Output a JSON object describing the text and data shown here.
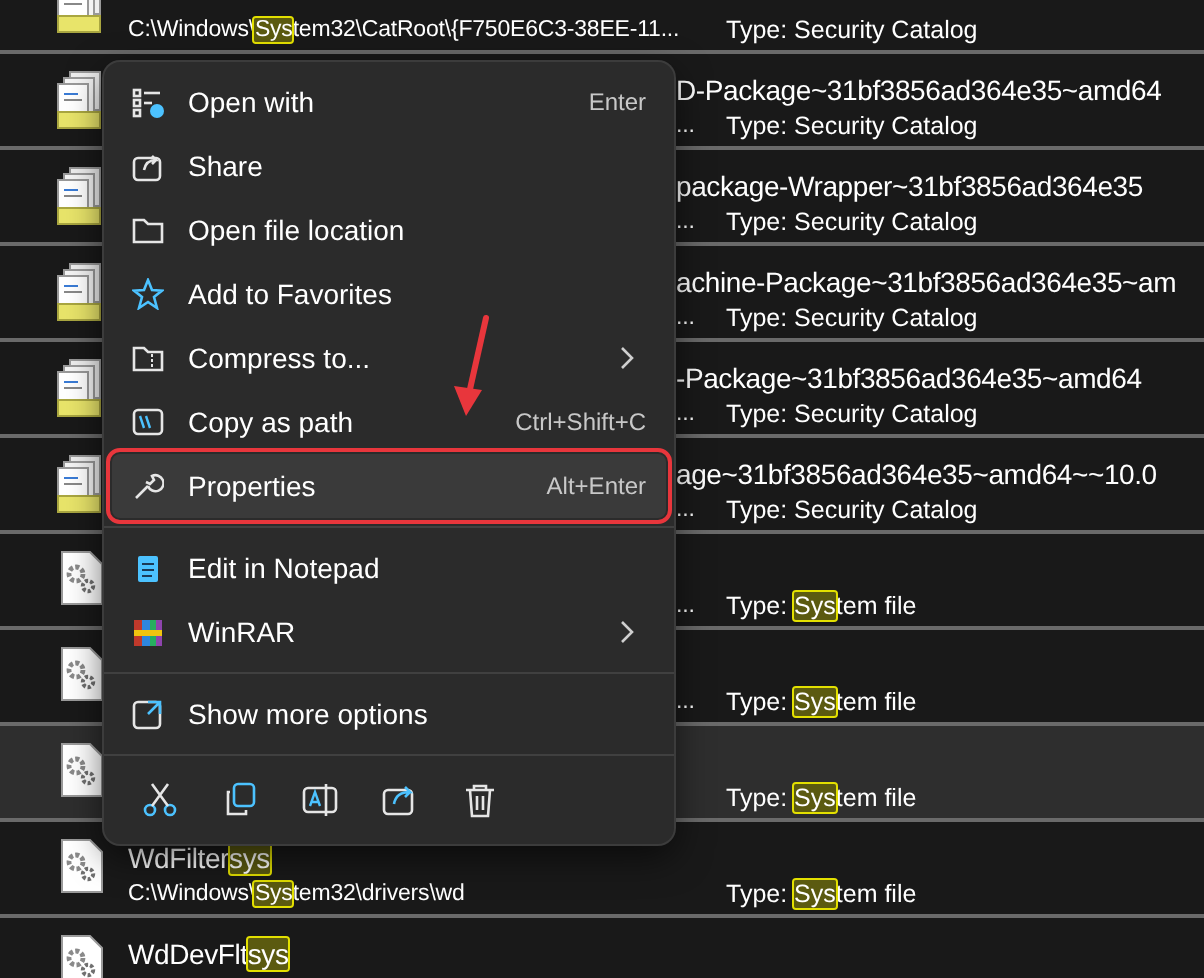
{
  "results": [
    {
      "kind": "catalog",
      "selected": false,
      "covered": false,
      "path": [
        {
          "text": "C:\\Windows\\",
          "match": false
        },
        {
          "text": "Sys",
          "match": true
        },
        {
          "text": "tem32\\CatRoot\\{F750E6C3-38EE-11...",
          "match": false
        }
      ],
      "type": [
        {
          "text": "Type: Security Catalog",
          "match": false
        }
      ]
    },
    {
      "kind": "catalog",
      "selected": false,
      "covered": true,
      "name": [
        {
          "text": "D-Package~31bf3856ad364e35~amd64",
          "match": false
        }
      ],
      "path": [
        {
          "text": "...",
          "match": false
        }
      ],
      "type": [
        {
          "text": "Type: Security Catalog",
          "match": false
        }
      ]
    },
    {
      "kind": "catalog",
      "selected": false,
      "covered": true,
      "name": [
        {
          "text": "package-Wrapper~31bf3856ad364e35",
          "match": false
        }
      ],
      "path": [
        {
          "text": "...",
          "match": false
        }
      ],
      "type": [
        {
          "text": "Type: Security Catalog",
          "match": false
        }
      ]
    },
    {
      "kind": "catalog",
      "selected": false,
      "covered": true,
      "name": [
        {
          "text": "achine-Package~31bf3856ad364e35~am",
          "match": false
        }
      ],
      "path": [
        {
          "text": "...",
          "match": false
        }
      ],
      "type": [
        {
          "text": "Type: Security Catalog",
          "match": false
        }
      ]
    },
    {
      "kind": "catalog",
      "selected": false,
      "covered": true,
      "name": [
        {
          "text": "-Package~31bf3856ad364e35~amd64",
          "match": false
        }
      ],
      "path": [
        {
          "text": "...",
          "match": false
        }
      ],
      "type": [
        {
          "text": "Type: Security Catalog",
          "match": false
        }
      ]
    },
    {
      "kind": "catalog",
      "selected": false,
      "covered": true,
      "name": [
        {
          "text": "age~31bf3856ad364e35~amd64~~10.0",
          "match": false
        }
      ],
      "path": [
        {
          "text": "...",
          "match": false
        }
      ],
      "type": [
        {
          "text": "Type: Security Catalog",
          "match": false
        }
      ]
    },
    {
      "kind": "system",
      "selected": false,
      "covered": true,
      "path": [
        {
          "text": "...",
          "match": false
        }
      ],
      "type": [
        {
          "text": "Type: ",
          "match": false
        },
        {
          "text": "Sys",
          "match": true
        },
        {
          "text": "tem file",
          "match": false
        }
      ]
    },
    {
      "kind": "system",
      "selected": false,
      "covered": true,
      "path": [
        {
          "text": "...",
          "match": false
        }
      ],
      "type": [
        {
          "text": "Type: ",
          "match": false
        },
        {
          "text": "Sys",
          "match": true
        },
        {
          "text": "tem file",
          "match": false
        }
      ]
    },
    {
      "kind": "system",
      "selected": true,
      "covered": true,
      "type": [
        {
          "text": "Type: ",
          "match": false
        },
        {
          "text": "Sys",
          "match": true
        },
        {
          "text": "tem file",
          "match": false
        }
      ]
    },
    {
      "kind": "system",
      "selected": false,
      "covered": false,
      "name": [
        {
          "text": "WdFilter",
          "match": false
        },
        {
          "text": "sys",
          "match": true
        }
      ],
      "path": [
        {
          "text": "C:\\Windows\\",
          "match": false
        },
        {
          "text": "Sys",
          "match": true
        },
        {
          "text": "tem32\\drivers\\wd",
          "match": false
        }
      ],
      "type": [
        {
          "text": "Type: ",
          "match": false
        },
        {
          "text": "Sys",
          "match": true
        },
        {
          "text": "tem file",
          "match": false
        }
      ]
    },
    {
      "kind": "system",
      "selected": false,
      "covered": false,
      "name": [
        {
          "text": "WdDevFlt",
          "match": false
        },
        {
          "text": "sys",
          "match": true
        }
      ]
    }
  ],
  "context_menu": {
    "items": [
      {
        "kind": "item",
        "label": "Open with",
        "shortcut": "Enter",
        "submenu": false,
        "highlighted": false
      },
      {
        "kind": "item",
        "label": "Share",
        "submenu": false,
        "highlighted": false
      },
      {
        "kind": "item",
        "label": "Open file location",
        "submenu": false,
        "highlighted": false
      },
      {
        "kind": "item",
        "label": "Add to Favorites",
        "submenu": false,
        "highlighted": false
      },
      {
        "kind": "item",
        "label": "Compress to...",
        "submenu": true,
        "highlighted": false
      },
      {
        "kind": "item",
        "label": "Copy as path",
        "shortcut": "Ctrl+Shift+C",
        "submenu": false,
        "highlighted": false
      },
      {
        "kind": "item",
        "label": "Properties",
        "shortcut": "Alt+Enter",
        "submenu": false,
        "highlighted": true
      },
      {
        "kind": "separator"
      },
      {
        "kind": "item",
        "label": "Edit in Notepad",
        "submenu": false,
        "highlighted": false
      },
      {
        "kind": "item",
        "label": "WinRAR",
        "submenu": true,
        "highlighted": false
      },
      {
        "kind": "separator"
      },
      {
        "kind": "item",
        "label": "Show more options",
        "submenu": false,
        "highlighted": false
      },
      {
        "kind": "separator"
      },
      {
        "kind": "toolbar"
      }
    ]
  }
}
